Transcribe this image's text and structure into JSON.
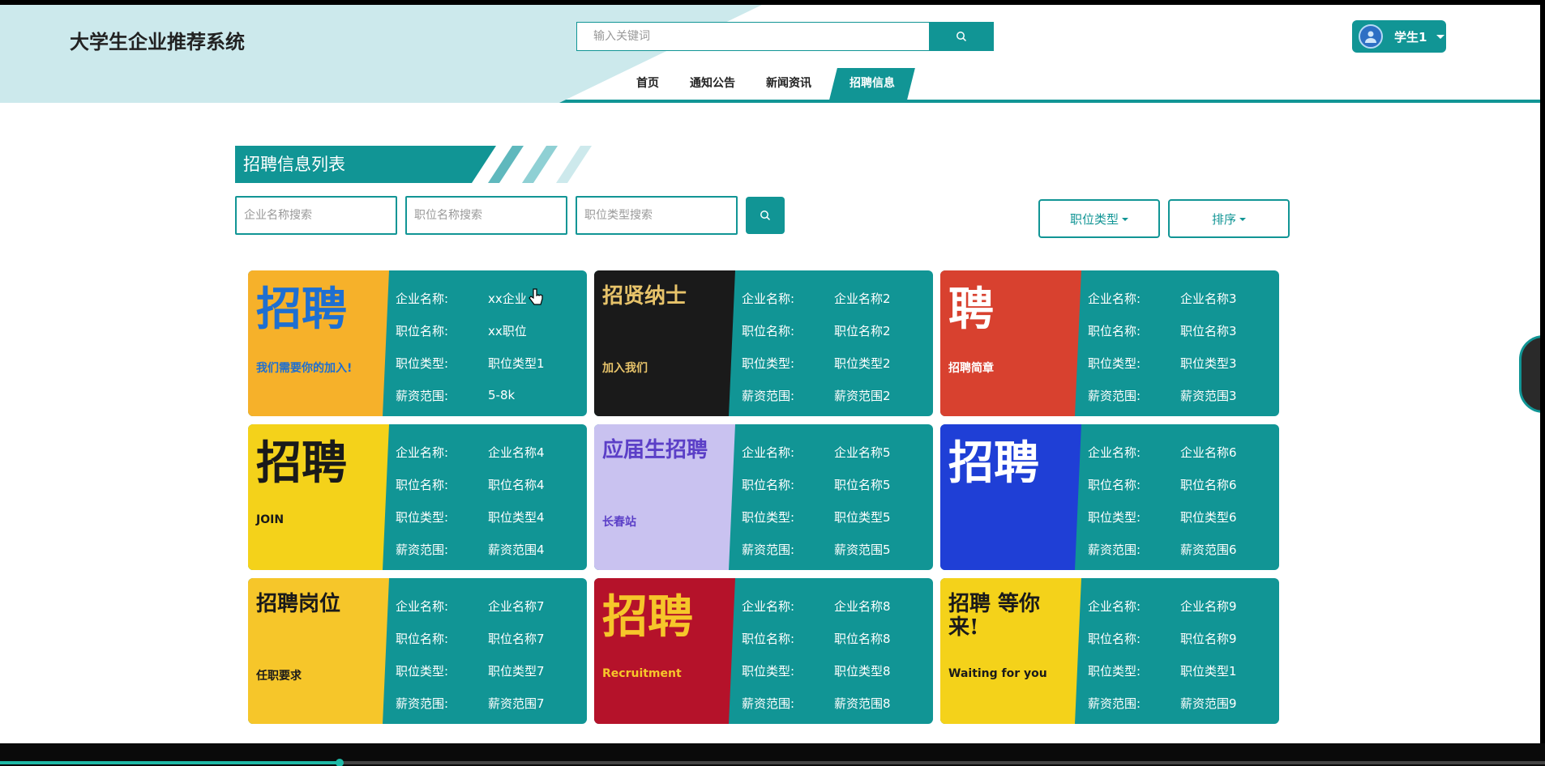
{
  "app": {
    "title": "大学生企业推荐系统"
  },
  "search": {
    "placeholder": "输入关键词"
  },
  "user": {
    "name": "学生1"
  },
  "nav": {
    "items": [
      "首页",
      "通知公告",
      "新闻资讯",
      "招聘信息"
    ],
    "active_index": 3
  },
  "section": {
    "title": "招聘信息列表"
  },
  "filters": {
    "company_placeholder": "企业名称搜索",
    "position_placeholder": "职位名称搜索",
    "type_placeholder": "职位类型搜索",
    "type_dropdown": "职位类型",
    "sort_dropdown": "排序"
  },
  "labels": {
    "company": "企业名称:",
    "position": "职位名称:",
    "type": "职位类型:",
    "salary": "薪资范围:"
  },
  "cards": [
    {
      "company": "xx企业",
      "position": "xx职位",
      "type": "职位类型1",
      "salary": "5-8k",
      "poster": {
        "bg": "#f6b12a",
        "text": "招聘",
        "sub": "我们需要你的加入!",
        "color": "#1e6fd1"
      }
    },
    {
      "company": "企业名称2",
      "position": "职位名称2",
      "type": "职位类型2",
      "salary": "薪资范围2",
      "poster": {
        "bg": "#1a1a1a",
        "text": "招贤纳士",
        "sub": "加入我们",
        "color": "#e7c36a"
      }
    },
    {
      "company": "企业名称3",
      "position": "职位名称3",
      "type": "职位类型3",
      "salary": "薪资范围3",
      "poster": {
        "bg": "#d8412f",
        "text": "聘",
        "sub": "招聘简章",
        "color": "#ffffff"
      }
    },
    {
      "company": "企业名称4",
      "position": "职位名称4",
      "type": "职位类型4",
      "salary": "薪资范围4",
      "poster": {
        "bg": "#f4d21a",
        "text": "招聘",
        "sub": "JOIN",
        "color": "#1a1a1a"
      }
    },
    {
      "company": "企业名称5",
      "position": "职位名称5",
      "type": "职位类型5",
      "salary": "薪资范围5",
      "poster": {
        "bg": "#c9c2f0",
        "text": "应届生招聘",
        "sub": "长春站",
        "color": "#5b3fc7"
      }
    },
    {
      "company": "企业名称6",
      "position": "职位名称6",
      "type": "职位类型6",
      "salary": "薪资范围6",
      "poster": {
        "bg": "#1f3fd6",
        "text": "招聘",
        "sub": "",
        "color": "#ffffff"
      }
    },
    {
      "company": "企业名称7",
      "position": "职位名称7",
      "type": "职位类型7",
      "salary": "薪资范围7",
      "poster": {
        "bg": "#f6c62a",
        "text": "招聘岗位",
        "sub": "任职要求",
        "color": "#1a1a1a"
      }
    },
    {
      "company": "企业名称8",
      "position": "职位名称8",
      "type": "职位类型8",
      "salary": "薪资范围8",
      "poster": {
        "bg": "#b5122a",
        "text": "招聘",
        "sub": "Recruitment",
        "color": "#f6c62a"
      }
    },
    {
      "company": "企业名称9",
      "position": "职位名称9",
      "type": "职位类型1",
      "salary": "薪资范围9",
      "poster": {
        "bg": "#f4d21a",
        "text": "招聘 等你来!",
        "sub": "Waiting for you",
        "color": "#1a1a1a"
      }
    }
  ],
  "colors": {
    "primary": "#119595",
    "header_tint": "#cce9ec"
  },
  "player": {
    "progress": 0.22
  }
}
